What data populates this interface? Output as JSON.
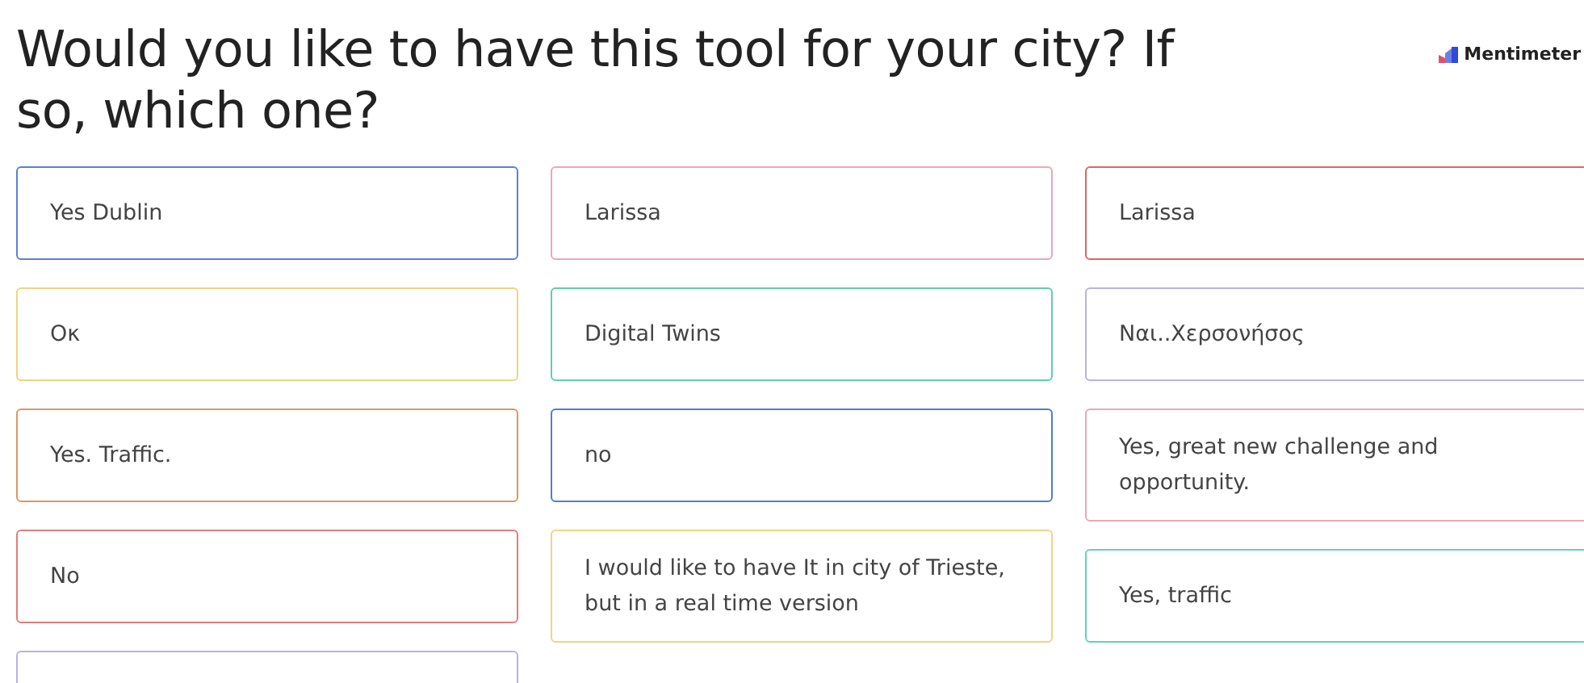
{
  "title": "Would you like to have this tool for your city? If so, which one?",
  "logo": "Mentimeter",
  "columns": [
    [
      {
        "text": "Yes Dublin",
        "color": "#5b80d6"
      },
      {
        "text": "Oκ",
        "color": "#f1d382"
      },
      {
        "text": "Yes. Traffic.",
        "color": "#d99866"
      },
      {
        "text": "No",
        "color": "#e27c7c"
      },
      {
        "color": "#b8b2e4"
      }
    ],
    [
      {
        "text": "Larissa",
        "color": "#eaa8b8"
      },
      {
        "text": "Digital Twins",
        "color": "#5fcfa6"
      },
      {
        "text": "no",
        "color": "#4f7fc8"
      },
      {
        "text": "I would like to have It in city of Trieste, but in a real time version",
        "color": "#f1d382"
      }
    ],
    [
      {
        "text": "Larissa",
        "color": "#e06464"
      },
      {
        "text": "Ναι..Χερσονήσος",
        "color": "#b8b2e4"
      },
      {
        "text": "Yes, great new challenge and opportunity.",
        "color": "#eaa8b8"
      },
      {
        "text": "Yes, traffic",
        "color": "#5fd3b8"
      }
    ]
  ]
}
